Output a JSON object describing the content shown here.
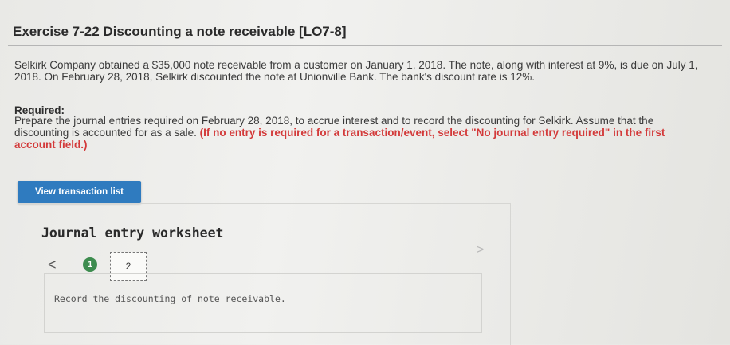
{
  "exercise": {
    "title": "Exercise 7-22 Discounting a note receivable [LO7-8]",
    "description": "Selkirk Company obtained a $35,000 note receivable from a customer on January 1, 2018. The note, along with interest at 9%, is due on July 1, 2018. On February 28, 2018, Selkirk discounted the note at Unionville Bank. The bank's discount rate is 12%.",
    "required_heading": "Required:",
    "required_text": "Prepare the journal entries required on February 28, 2018, to accrue interest and to record the discounting for Selkirk. Assume that the discounting is accounted for as a sale.",
    "required_note": "(If no entry is required for a transaction/event, select \"No journal entry required\" in the first account field.)"
  },
  "toolbar": {
    "view_transactions_label": "View transaction list"
  },
  "worksheet": {
    "title": "Journal entry worksheet",
    "prev_glyph": "<",
    "next_glyph": ">",
    "steps": [
      {
        "label": "1",
        "state": "completed"
      },
      {
        "label": "2",
        "state": "current"
      }
    ],
    "instruction": "Record the discounting of note receivable."
  },
  "colors": {
    "button_bg": "#2f7bbf",
    "instruction_red": "#d33a3a",
    "step_done_green": "#3d8c4f"
  },
  "icons": {
    "prev": "chevron-left-icon",
    "next": "chevron-right-icon"
  }
}
